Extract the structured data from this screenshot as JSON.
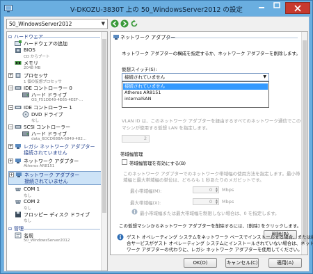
{
  "window": {
    "title": "V-DKOZU-3830T 上の 50_WindowsServer2012 の設定"
  },
  "toolbar": {
    "vm_name": "50_WindowsServer2012"
  },
  "tree": {
    "hardware_header": "ハードウェア",
    "management_header": "管理",
    "items": [
      {
        "label": "ハードウェアの追加",
        "sub": ""
      },
      {
        "label": "BIOS",
        "sub": "CD からブート"
      },
      {
        "label": "メモリ",
        "sub": "2048 MB"
      },
      {
        "label": "プロセッサ",
        "sub": "1 個の仮想プロセッサ"
      },
      {
        "label": "IDE コントローラー 0",
        "sub": ""
      },
      {
        "label": "ハード ドライブ",
        "sub": "OS_F51DE49-4E65-4EEF-..."
      },
      {
        "label": "IDE コントローラー 1",
        "sub": ""
      },
      {
        "label": "DVD ドライブ",
        "sub": "なし"
      },
      {
        "label": "SCSI コントローラー",
        "sub": ""
      },
      {
        "label": "ハード ドライブ",
        "sub": "data_6DCD68BA-6849-482..."
      },
      {
        "label": "レガシ ネットワーク アダプター",
        "sub": "接続されていません"
      },
      {
        "label": "ネットワーク アダプター",
        "sub": "Atheros AR8151"
      },
      {
        "label": "ネットワーク アダプター",
        "sub": "接続されていません"
      },
      {
        "label": "COM 1",
        "sub": "なし"
      },
      {
        "label": "COM 2",
        "sub": "なし"
      },
      {
        "label": "フロッピー ディスク ドライブ",
        "sub": "なし"
      },
      {
        "label": "名前",
        "sub": "50_WindowsServer2012"
      }
    ]
  },
  "panel": {
    "title": "ネットワーク アダプター",
    "description": "ネットワーク アダプターの構成を指定するか、ネットワーク アダプターを削除します。",
    "switch_label": "仮想スイッチ(S):",
    "switch_value": "接続されていません",
    "switch_options": [
      "接続されていません",
      "Atheros AR8151",
      "internalSAN"
    ],
    "vlan_text_1": "VLAN ID は、このネットワーク アダプターを経由するすべてのネットワーク通信でこの仮想",
    "vlan_text_2": "マシンが使用する仮想 LAN を指定します。",
    "vlan_value": "2",
    "bandwidth_header": "帯域幅管理",
    "bandwidth_checkbox": "帯域幅管理を有効にする(B)",
    "bandwidth_desc_1": "このネットワーク アダプターでのネットワーク帯域幅の使用方法を指定します。最小帯",
    "bandwidth_desc_2": "域幅と最大帯域幅の単位は、どちらも 1 秒あたりのメガビットです。",
    "min_label": "最小帯域幅(M):",
    "min_value": "0",
    "max_label": "最大帯域幅(X):",
    "max_value": "0",
    "unit": "Mbps",
    "limit_note": "最小帯域幅または最大帯域幅を制限しない場合は、0 を指定します。",
    "remove_text": "この仮想マシンからネットワーク アダプターを削除するには、[削除] をクリックします。",
    "remove_button": "削除(R)",
    "info_text_1": "ゲスト オペレーティング システムをネットワーク ベースでインストールする場合、または統",
    "info_text_2": "合サービスがゲスト オペレーティング システムにインストールされていない場合は、ネット",
    "info_text_3": "ワーク アダプターの代わりに、レガシ ネットワーク アダプターを使用してください。"
  },
  "footer": {
    "ok": "OK(O)",
    "cancel": "キャンセル(C)",
    "apply": "適用(A)"
  },
  "colors": {
    "accent": "#3399ff",
    "title_bar": "#6aaee0",
    "close": "#c7392e",
    "link_blue": "#1a3a8a"
  }
}
